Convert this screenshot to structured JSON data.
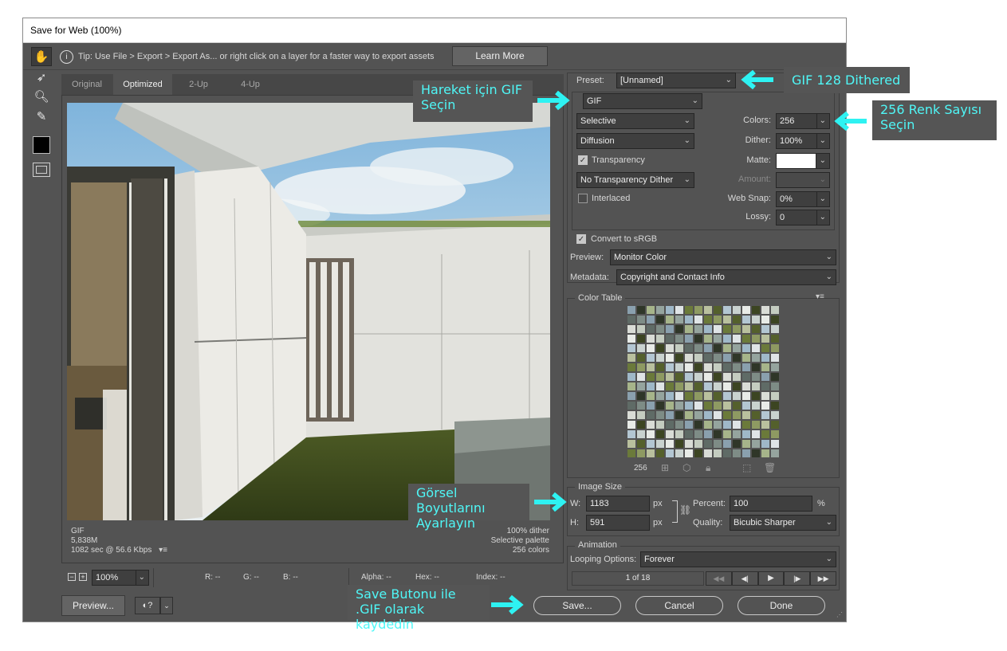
{
  "window": {
    "title": "Save for Web (100%)"
  },
  "tip": {
    "text": "Tip: Use File > Export > Export As...  or right click on a layer for a faster way to export assets",
    "learn_more": "Learn More"
  },
  "tabs": [
    "Original",
    "Optimized",
    "2-Up",
    "4-Up"
  ],
  "active_tab": "Optimized",
  "image_info": {
    "format": "GIF",
    "size": "5,838M",
    "time": "1082 sec @ 56.6 Kbps",
    "dither": "100% dither",
    "palette": "Selective palette",
    "colors": "256 colors"
  },
  "status": {
    "zoom": "100%",
    "r": "R: --",
    "g": "G: --",
    "b": "B: --",
    "alpha": "Alpha: --",
    "hex": "Hex: --",
    "index": "Index: --"
  },
  "bottom": {
    "preview": "Preview...",
    "save": "Save...",
    "cancel": "Cancel",
    "done": "Done"
  },
  "settings": {
    "preset_label": "Preset:",
    "preset_value": "[Unnamed]",
    "format": "GIF",
    "reduction": "Selective",
    "dither_algo": "Diffusion",
    "transparency": "Transparency",
    "transparency_dither": "No Transparency Dither",
    "interlaced": "Interlaced",
    "colors_label": "Colors:",
    "colors_value": "256",
    "dither_label": "Dither:",
    "dither_value": "100%",
    "matte_label": "Matte:",
    "amount_label": "Amount:",
    "websnap_label": "Web Snap:",
    "websnap_value": "0%",
    "lossy_label": "Lossy:",
    "lossy_value": "0",
    "convert_srgb": "Convert to sRGB",
    "preview_label": "Preview:",
    "preview_value": "Monitor Color",
    "metadata_label": "Metadata:",
    "metadata_value": "Copyright and Contact Info"
  },
  "color_table": {
    "title": "Color Table",
    "count": "256"
  },
  "image_size": {
    "title": "Image Size",
    "w_label": "W:",
    "w_value": "1183",
    "h_label": "H:",
    "h_value": "591",
    "px": "px",
    "percent_label": "Percent:",
    "percent_value": "100",
    "percent_unit": "%",
    "quality_label": "Quality:",
    "quality_value": "Bicubic Sharper"
  },
  "animation": {
    "title": "Animation",
    "looping_label": "Looping Options:",
    "looping_value": "Forever",
    "frame": "1 of 18"
  },
  "annotations": {
    "preset": "GIF 128 Dithered",
    "format": "Hareket için GIF\nSeçin",
    "colors": "256 Renk Sayısı\nSeçin",
    "size": "Görsel Boyutlarını\nAyarlayın",
    "save": "Save Butonu ile\n.GIF olarak kaydedin"
  },
  "colors": {
    "annotation_text": "#4ff7f7",
    "arrow": "#2ef2f2",
    "panel_bg": "#535353"
  }
}
